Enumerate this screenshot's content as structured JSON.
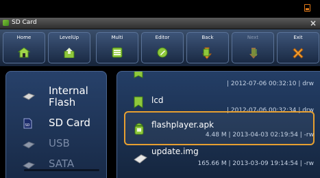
{
  "window": {
    "title": "SD Card"
  },
  "toolbar": {
    "buttons": [
      {
        "label": "Home"
      },
      {
        "label": "LevelUp"
      },
      {
        "label": "Multi"
      },
      {
        "label": "Editor"
      },
      {
        "label": "Back"
      },
      {
        "label": "Next"
      },
      {
        "label": "Exit"
      }
    ]
  },
  "devices": [
    {
      "label_line1": "Internal",
      "label_line2": "Flash"
    },
    {
      "label": "SD Card"
    },
    {
      "label": "USB"
    },
    {
      "label": "SATA"
    }
  ],
  "files": [
    {
      "name": "",
      "meta": "| 2012-07-06 00:32:10 | drw"
    },
    {
      "name": "lcd",
      "meta": "| 2012-07-06 00:32:34 | drw"
    },
    {
      "name": "flashplayer.apk",
      "meta": "4.48 M | 2013-04-03 02:19:54 | -rw"
    },
    {
      "name": "update.img",
      "meta": "165.66 M | 2013-03-09 19:14:54 | -rw"
    }
  ],
  "colors": {
    "accent": "#e8a030",
    "panel": "#243e66",
    "toolbar": "#3a4e6a"
  }
}
